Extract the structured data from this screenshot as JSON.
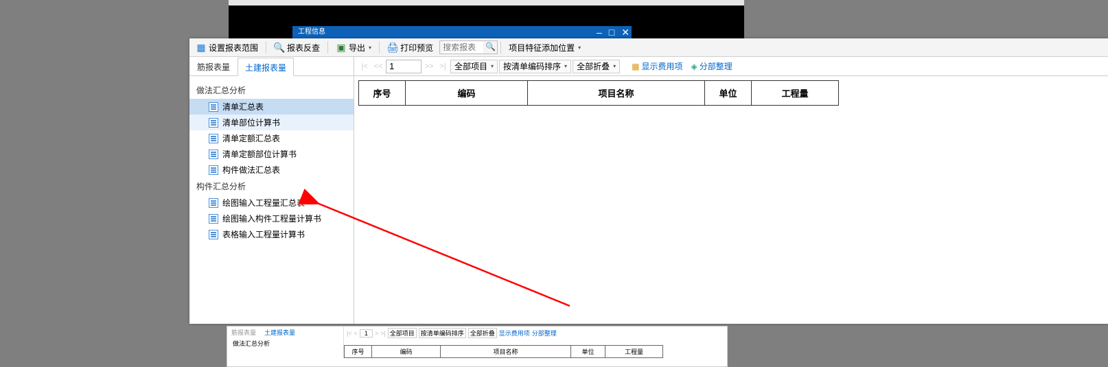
{
  "bg_window_title": "工程信息",
  "toolbar": {
    "set_range": "设置报表范围",
    "report_back": "报表反查",
    "export": "导出",
    "print_preview": "打印预览",
    "search_placeholder": "搜索报表",
    "feature_add_pos": "项目特征添加位置"
  },
  "tabs": {
    "rebar": "筋报表量",
    "civil": "土建报表量"
  },
  "tree": {
    "group1": "做法汇总分析",
    "items1": [
      "清单汇总表",
      "清单部位计算书",
      "清单定额汇总表",
      "清单定额部位计算书",
      "构件做法汇总表"
    ],
    "group2": "构件汇总分析",
    "items2": [
      "绘图输入工程量汇总表",
      "绘图输入构件工程量计算书",
      "表格输入工程量计算书"
    ]
  },
  "secondary": {
    "page": "1",
    "all_projects": "全部项目",
    "sort_by_code": "按清单编码排序",
    "collapse_all": "全部折叠",
    "show_fee_items": "显示费用项",
    "section_organize": "分部整理"
  },
  "table": {
    "col_seq": "序号",
    "col_code": "编码",
    "col_name": "项目名称",
    "col_unit": "单位",
    "col_qty": "工程量"
  },
  "thumb": {
    "tab1": "筋报表量",
    "tab2": "土建报表量",
    "group": "做法汇总分析",
    "all_projects": "全部项目",
    "sort": "按清单编码排序",
    "collapse": "全部折叠",
    "show_fee": "显示费用项",
    "section": "分部整理",
    "c1": "序号",
    "c2": "编码",
    "c3": "项目名称",
    "c4": "单位",
    "c5": "工程量"
  }
}
